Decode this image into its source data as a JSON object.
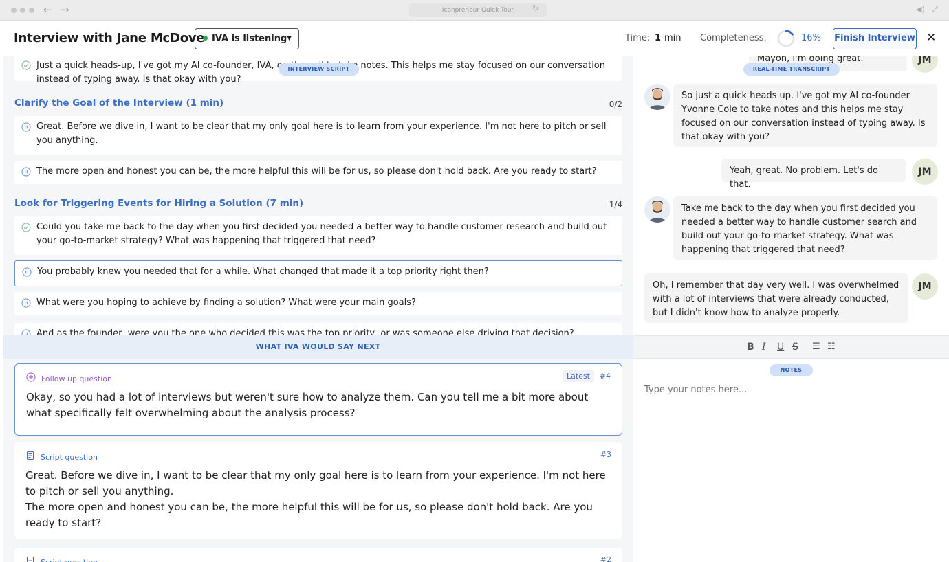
{
  "browser": {
    "url": "Icanpreneur Quick Tour"
  },
  "header": {
    "title": "Interview with Jane McDove",
    "listen_status": "IVA is listening",
    "time_label": "Time:",
    "time_value": "1",
    "time_unit": "min",
    "completeness_label": "Completeness:",
    "completeness_percent": "16%",
    "completeness_fraction": 0.16,
    "finish_button": "Finish Interview",
    "colors": {
      "accent": "#3b6fc4",
      "listening": "#2fa84f"
    }
  },
  "script": {
    "pill": "INTERVIEW SCRIPT",
    "intro_question": "Just a quick heads-up, I've got my AI co-founder, IVA, on the call to take notes. This helps me stay focused on our conversation instead of typing away. Is that okay with you?",
    "sections": [
      {
        "title": "Clarify the Goal of the Interview (1 min)",
        "count": "0/2",
        "questions": [
          "Great. Before we dive in, I want to be clear that my only goal here is to learn from your experience. I'm not here to pitch or sell you anything.",
          "The more open and honest you can be, the more helpful this will be for us, so please don't hold back. Are you ready to start?"
        ]
      },
      {
        "title": "Look for Triggering Events for Hiring a Solution (7 min)",
        "count": "1/4",
        "questions": [
          "Could you take me back to the day when you first decided you needed a better way to handle customer research and build out your go-to-market strategy? What was happening that triggered that need?",
          "You probably knew you needed that for a while. What changed that made it a top priority right then?",
          "What were you hoping to achieve by finding a solution? What were your main goals?",
          "And as the founder, were you the one who decided this was the top priority, or was someone else driving that decision?"
        ]
      }
    ]
  },
  "next": {
    "bar_label": "WHAT IVA WOULD SAY NEXT",
    "cards": [
      {
        "type": "Follow up question",
        "badge": "Latest",
        "number": "#4",
        "text": "Okay, so you had a lot of interviews but weren't sure how to analyze them. Can you tell me a bit more about what specifically felt overwhelming about the analysis process?"
      },
      {
        "type": "Script question",
        "number": "#3",
        "text1": "Great. Before we dive in, I want to be clear that my only goal here is to learn from your experience. I'm not here to pitch or sell you anything.",
        "text2": "The more open and honest you can be, the more helpful this will be for us, so please don't hold back. Are you ready to start?"
      },
      {
        "type": "Script question",
        "number": "#2"
      }
    ]
  },
  "transcript": {
    "pill": "REAL-TIME TRANSCRIPT",
    "initials": "JM",
    "messages": [
      {
        "speaker": "JM",
        "text": "Mayon, I'm doing great. Thanks."
      },
      {
        "speaker": "interviewer",
        "text": "So just a quick heads up. I've got my AI co-founder Yvonne Cole to take notes and this helps me stay focused on our conversation instead of typing away. Is that okay with you?"
      },
      {
        "speaker": "JM",
        "text": "Yeah, great. No problem. Let's do that."
      },
      {
        "speaker": "interviewer",
        "text": "Take me back to the day when you first decided you needed a better way to handle customer search and build out your go-to-market strategy. What was happening that triggered that need?"
      },
      {
        "speaker": "JM",
        "text": "Oh, I remember that day very well. I was overwhelmed with a lot of interviews that were already conducted, but I didn't know how to analyze properly."
      }
    ]
  },
  "notes": {
    "toolbar": {
      "bold": "B",
      "italic": "I",
      "underline": "U",
      "strike": "S"
    },
    "pill": "NOTES",
    "placeholder": "Type your notes here..."
  }
}
